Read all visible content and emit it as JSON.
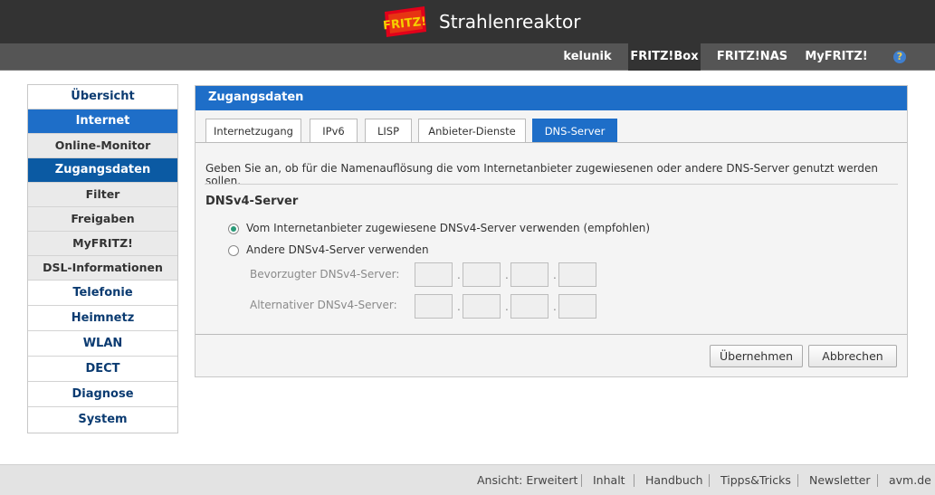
{
  "header": {
    "logo_text": "FRITZ!",
    "title": "Strahlenreaktor",
    "user": "kelunik",
    "nav": [
      "FRITZ!Box",
      "FRITZ!NAS",
      "MyFRITZ!"
    ],
    "help": "?"
  },
  "sidebar": {
    "items": [
      "Übersicht",
      "Internet",
      "Online-Monitor",
      "Zugangsdaten",
      "Filter",
      "Freigaben",
      "MyFRITZ!",
      "DSL-Informationen",
      "Telefonie",
      "Heimnetz",
      "WLAN",
      "DECT",
      "Diagnose",
      "System"
    ]
  },
  "main": {
    "heading": "Zugangsdaten",
    "tabs": [
      "Internetzugang",
      "IPv6",
      "LISP",
      "Anbieter-Dienste",
      "DNS-Server"
    ],
    "description": "Geben Sie an, ob für die Namenauflösung die vom Internetanbieter zugewiesenen oder andere DNS-Server genutzt werden sollen.",
    "section_title": "DNSv4-Server",
    "option1": "Vom Internetanbieter zugewiesene DNSv4-Server verwenden (empfohlen)",
    "option2": "Andere DNSv4-Server verwenden",
    "preferred_label": "Bevorzugter DNSv4-Server:",
    "alternate_label": "Alternativer DNSv4-Server:",
    "apply_button": "Übernehmen",
    "cancel_button": "Abbrechen"
  },
  "footer": {
    "links": [
      "Ansicht: Erweitert",
      "Inhalt",
      "Handbuch",
      "Tipps&Tricks",
      "Newsletter",
      "avm.de"
    ]
  },
  "colors": {
    "header_bg": "#333333",
    "accent_blue": "#1e6ec8",
    "selected_blue": "#0b5aa3",
    "radio_green": "#2a9a78"
  }
}
